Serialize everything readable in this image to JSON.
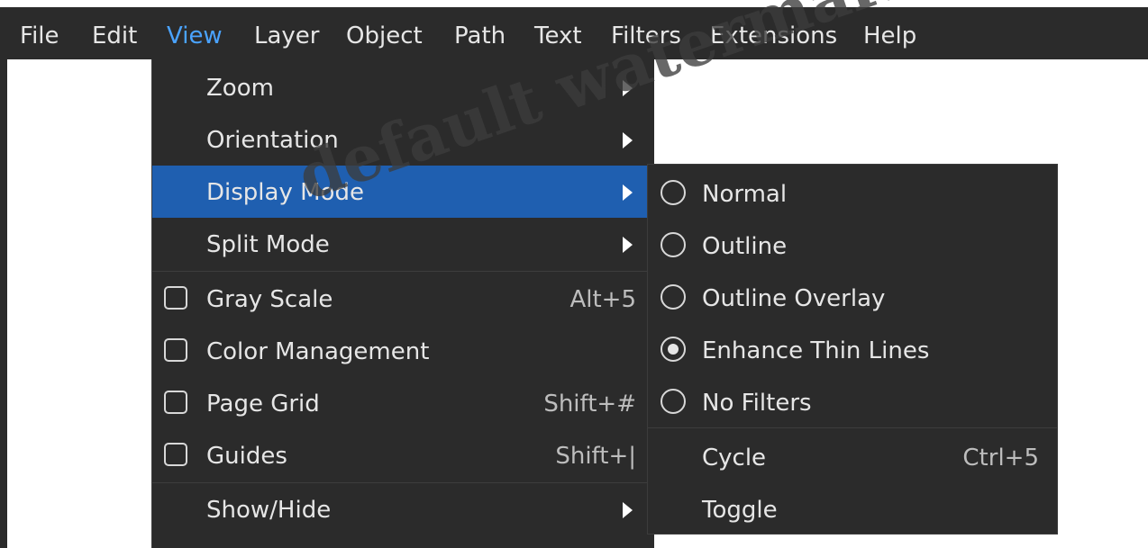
{
  "menubar": {
    "items": [
      "File",
      "Edit",
      "View",
      "Layer",
      "Object",
      "Path",
      "Text",
      "Filters",
      "Extensions",
      "Help"
    ],
    "active": "View"
  },
  "view_menu": {
    "items": [
      {
        "label": "Zoom",
        "submenu": true
      },
      {
        "label": "Orientation",
        "submenu": true
      },
      {
        "label": "Display Mode",
        "submenu": true,
        "highlighted": true
      },
      {
        "label": "Split Mode",
        "submenu": true
      },
      {
        "label": "Gray Scale",
        "checkbox": true,
        "checked": false,
        "shortcut": "Alt+5"
      },
      {
        "label": "Color Management",
        "checkbox": true,
        "checked": false
      },
      {
        "label": "Page Grid",
        "checkbox": true,
        "checked": false,
        "shortcut": "Shift+#"
      },
      {
        "label": "Guides",
        "checkbox": true,
        "checked": false,
        "shortcut": "Shift+|"
      },
      {
        "label": "Show/Hide",
        "submenu": true
      }
    ]
  },
  "display_mode_submenu": {
    "items": [
      {
        "label": "Normal",
        "radio": true,
        "selected": false
      },
      {
        "label": "Outline",
        "radio": true,
        "selected": false
      },
      {
        "label": "Outline Overlay",
        "radio": true,
        "selected": false
      },
      {
        "label": "Enhance Thin Lines",
        "radio": true,
        "selected": true
      },
      {
        "label": "No Filters",
        "radio": true,
        "selected": false
      },
      {
        "label": "Cycle",
        "shortcut": "Ctrl+5"
      },
      {
        "label": "Toggle"
      }
    ]
  },
  "watermark": "default watermark",
  "colors": {
    "menu_bg": "#2b2b2b",
    "highlight": "#1f5fb0",
    "active_menu_text": "#4aa3ff",
    "text": "#e6e6e6"
  }
}
